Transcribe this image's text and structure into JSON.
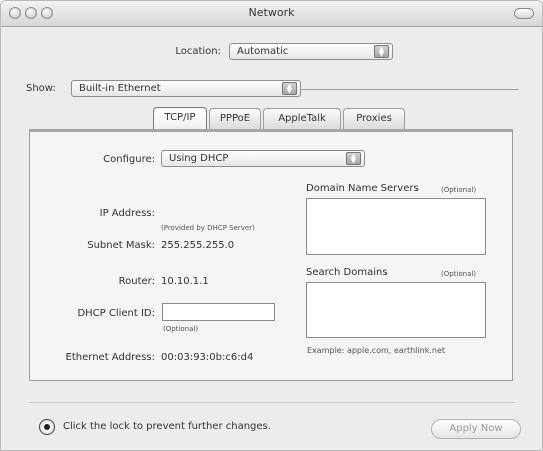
{
  "window": {
    "title": "Network"
  },
  "location": {
    "label": "Location:",
    "value": "Automatic"
  },
  "show": {
    "label": "Show:",
    "value": "Built-in Ethernet"
  },
  "tabs": [
    {
      "label": "TCP/IP",
      "active": true
    },
    {
      "label": "PPPoE",
      "active": false
    },
    {
      "label": "AppleTalk",
      "active": false
    },
    {
      "label": "Proxies",
      "active": false
    }
  ],
  "tcpip": {
    "configure_label": "Configure:",
    "configure_value": "Using DHCP",
    "ip_address_label": "IP Address:",
    "ip_address_note": "(Provided by DHCP Server)",
    "subnet_mask_label": "Subnet Mask:",
    "subnet_mask_value": "255.255.255.0",
    "router_label": "Router:",
    "router_value": "10.10.1.1",
    "dhcp_client_id_label": "DHCP Client ID:",
    "dhcp_client_id_value": "",
    "dhcp_client_id_note": "(Optional)",
    "ethernet_address_label": "Ethernet Address:",
    "ethernet_address_value": "00:03:93:0b:c6:d4",
    "dns_label": "Domain Name Servers",
    "dns_optional": "(Optional)",
    "dns_value": "",
    "search_domains_label": "Search Domains",
    "search_domains_optional": "(Optional)",
    "search_domains_value": "",
    "example_text": "Example: apple.com, earthlink.net"
  },
  "footer": {
    "lock_text": "Click the lock to prevent further changes.",
    "apply_label": "Apply Now"
  },
  "colors": {
    "window_bg": "#ececec",
    "pane_bg": "#f5f5f5",
    "disabled_text": "#9a9a9a"
  }
}
